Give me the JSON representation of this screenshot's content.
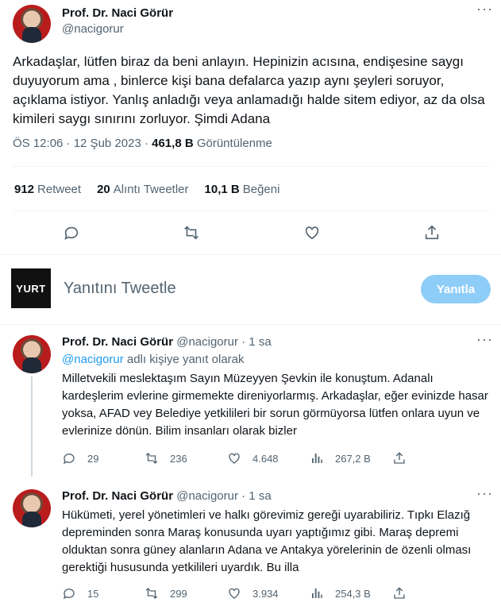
{
  "main_tweet": {
    "name": "Prof. Dr. Naci Görür",
    "handle": "@nacigorur",
    "text": "Arkadaşlar, lütfen biraz da beni anlayın. Hepinizin acısına, endişesine saygı duyuyorum ama , binlerce kişi bana defalarca yazıp aynı şeyleri soruyor, açıklama istiyor. Yanlış anladığı veya anlamadığı halde sitem ediyor, az da olsa kimileri saygı sınırını zorluyor. Şimdi Adana",
    "time": "ÖS 12:06 · 12 Şub 2023 · ",
    "views": "461,8 B",
    "views_label": " Görüntülenme",
    "stats": {
      "retweets": "912",
      "retweets_label": "Retweet",
      "quotes": "20",
      "quotes_label": "Alıntı Tweetler",
      "likes": "10,1 B",
      "likes_label": "Beğeni"
    }
  },
  "composer": {
    "logo": "YURT",
    "placeholder": "Yanıtını Tweetle",
    "button": "Yanıtla"
  },
  "replies": [
    {
      "name": "Prof. Dr. Naci Görür",
      "handle": "@nacigorur · 1 sa",
      "reply_to_link": "@nacigorur",
      "reply_to_rest": " adlı kişiye yanıt olarak",
      "text": "Milletvekili meslektaşım Sayın Müzeyyen Şevkin ile konuştum. Adanalı kardeşlerim evlerine girmemekte direniyorlarmış. Arkadaşlar, eğer evinizde hasar yoksa, AFAD vey Belediye yetkilileri bir sorun görmüyorsa lütfen onlara uyun ve evlerinize dönün. Bilim insanları olarak bizler",
      "replies": "29",
      "retweets": "236",
      "likes": "4.648",
      "views": "267,2 B"
    },
    {
      "name": "Prof. Dr. Naci Görür",
      "handle": "@nacigorur · 1 sa",
      "text": "Hükümeti, yerel yönetimleri ve halkı görevimiz gereği uyarabiliriz. Tıpkı Elazığ depreminden sonra Maraş konusunda uyarı yaptığımız gibi. Maraş depremi olduktan sonra güney alanların Adana ve Antakya yörelerinin de özenli olması gerektiği hususunda yetkilileri uyardık. Bu illa",
      "replies": "15",
      "retweets": "299",
      "likes": "3.934",
      "views": "254,3 B"
    }
  ],
  "icons": [
    "reply-icon",
    "retweet-icon",
    "like-icon",
    "share-icon",
    "views-icon",
    "more-icon"
  ],
  "colors": {
    "accent": "#1d9bf0",
    "muted": "#536471",
    "button_disabled": "#8ecdf8"
  }
}
